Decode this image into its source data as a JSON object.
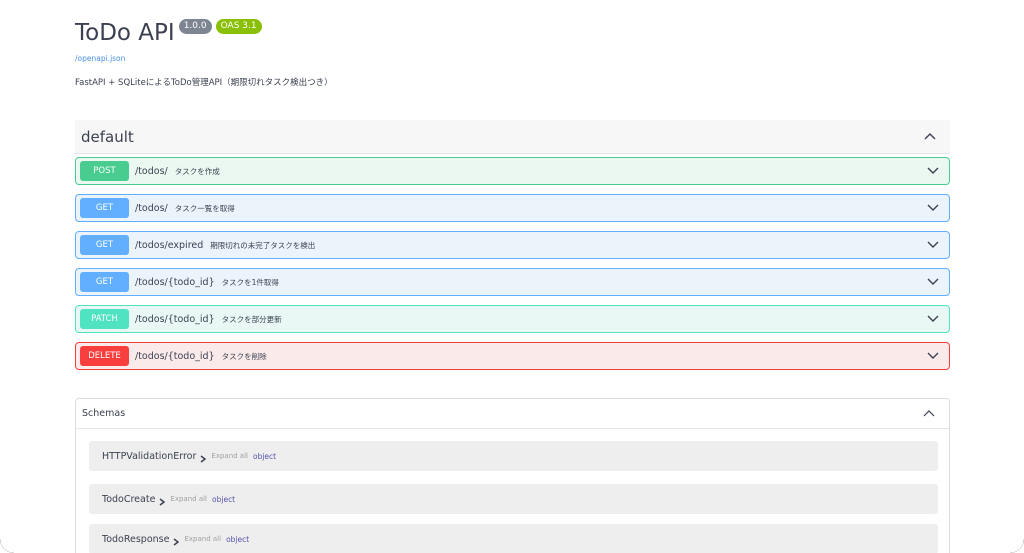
{
  "info": {
    "title": "ToDo API",
    "version_badge": "1.0.0",
    "oas_badge": "OAS 3.1",
    "spec_link": "/openapi.json",
    "description": "FastAPI + SQLiteによるToDo管理API（期限切れタスク検出つき）"
  },
  "tag": {
    "name": "default"
  },
  "operations": [
    {
      "method": "POST",
      "path": "/todos/",
      "summary": "タスクを作成"
    },
    {
      "method": "GET",
      "path": "/todos/",
      "summary": "タスク一覧を取得"
    },
    {
      "method": "GET",
      "path": "/todos/expired",
      "summary": "期限切れの未完了タスクを検出"
    },
    {
      "method": "GET",
      "path": "/todos/{todo_id}",
      "summary": "タスクを1件取得"
    },
    {
      "method": "PATCH",
      "path": "/todos/{todo_id}",
      "summary": "タスクを部分更新"
    },
    {
      "method": "DELETE",
      "path": "/todos/{todo_id}",
      "summary": "タスクを削除"
    }
  ],
  "schemas": {
    "title": "Schemas",
    "models": [
      {
        "name": "HTTPValidationError",
        "expand": "Expand all",
        "type": "object"
      },
      {
        "name": "TodoCreate",
        "expand": "Expand all",
        "type": "object"
      },
      {
        "name": "TodoResponse",
        "expand": "Expand all",
        "type": "object"
      }
    ]
  },
  "colors": {
    "post": "#49cc90",
    "get": "#61affe",
    "patch": "#50e3c2",
    "delete": "#f93e3e",
    "version_badge": "#7d8492",
    "oas_badge": "#89bf04",
    "link": "#4990e2"
  },
  "icons": {
    "collapse": "chevron-up-icon",
    "expand": "chevron-down-icon",
    "model_expand": "chevron-right-icon"
  }
}
